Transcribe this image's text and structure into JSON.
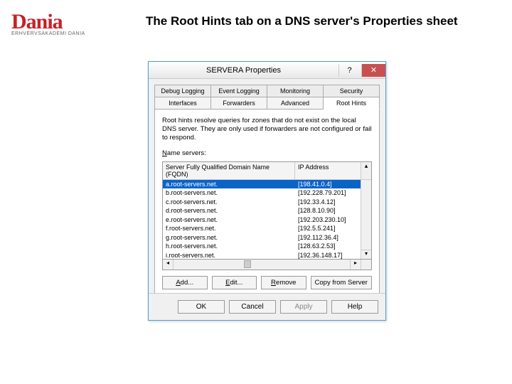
{
  "logo": {
    "script": "Dania",
    "sub": "ERHVERVSAKADEMI DANIA"
  },
  "slide_title": "The Root Hints tab on a DNS server's Properties sheet",
  "dialog": {
    "title": "SERVERA Properties",
    "help_btn": "?",
    "close_btn": "✕",
    "tabs_row1": [
      "Debug Logging",
      "Event Logging",
      "Monitoring",
      "Security"
    ],
    "tabs_row2": [
      "Interfaces",
      "Forwarders",
      "Advanced",
      "Root Hints"
    ],
    "description": "Root hints resolve queries for zones that do not exist on the local DNS server. They are only used if forwarders are not configured or fail to respond.",
    "ns_label_pre": "N",
    "ns_label_rest": "ame servers:",
    "header": {
      "name": "Server Fully Qualified Domain Name (FQDN)",
      "ip": "IP Address"
    },
    "rows": [
      {
        "name": "a.root-servers.net.",
        "ip": "[198.41.0.4]",
        "selected": true
      },
      {
        "name": "b.root-servers.net.",
        "ip": "[192.228.79.201]"
      },
      {
        "name": "c.root-servers.net.",
        "ip": "[192.33.4.12]"
      },
      {
        "name": "d.root-servers.net.",
        "ip": "[128.8.10.90]"
      },
      {
        "name": "e.root-servers.net.",
        "ip": "[192.203.230.10]"
      },
      {
        "name": "f.root-servers.net.",
        "ip": "[192.5.5.241]"
      },
      {
        "name": "g.root-servers.net.",
        "ip": "[192.112.36.4]"
      },
      {
        "name": "h.root-servers.net.",
        "ip": "[128.63.2.53]"
      },
      {
        "name": "i.root-servers.net.",
        "ip": "[192.36.148.17]"
      }
    ],
    "buttons": {
      "add": "Add...",
      "edit": "Edit...",
      "remove": "Remove",
      "copy": "Copy from Server"
    },
    "dialog_buttons": {
      "ok": "OK",
      "cancel": "Cancel",
      "apply": "Apply",
      "help": "Help"
    }
  }
}
